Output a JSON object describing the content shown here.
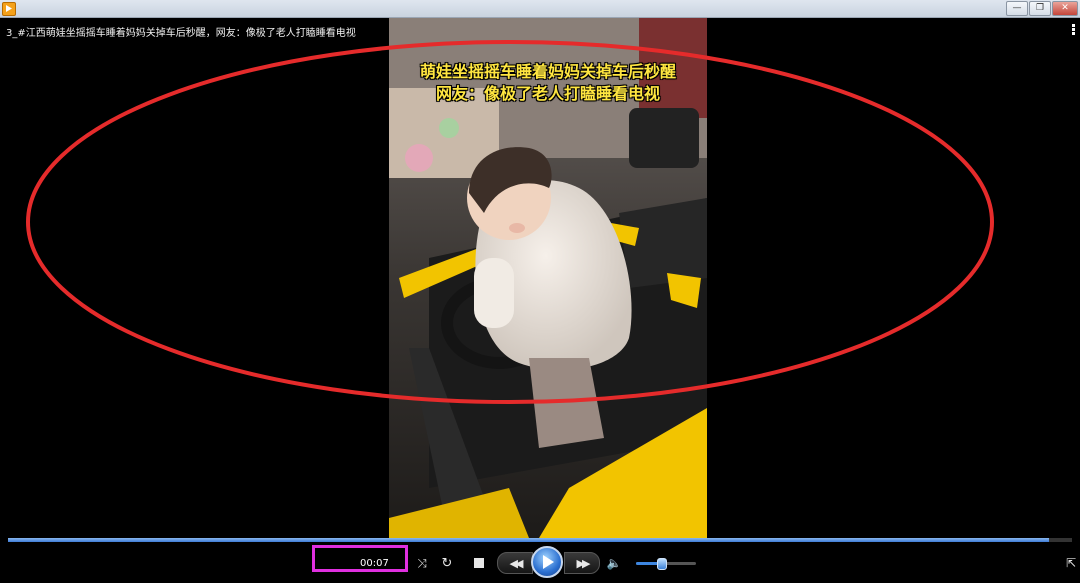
{
  "window": {
    "title": "3_#江西萌娃坐摇摇车睡着妈妈关掉车后秒醒，网友：像极了老人打瞌睡看电视",
    "buttons": {
      "minimize": "—",
      "maximize": "❐",
      "close": "✕"
    }
  },
  "video": {
    "caption_line1": "萌娃坐摇摇车睡着妈妈关掉车后秒醒",
    "caption_line2": "网友：像极了老人打瞌睡看电视",
    "progress_fraction": 0.978
  },
  "annotations": {
    "ellipse_color": "#e52b2b",
    "time_highlight_color": "#e030e0"
  },
  "controls": {
    "time": "00:07",
    "volume_fraction": 0.42,
    "icons": {
      "shuffle": "shuffle-icon",
      "repeat": "repeat-icon",
      "stop": "stop-icon",
      "previous": "previous-icon",
      "play": "play-icon",
      "next": "next-icon",
      "volume": "volume-icon",
      "fullscreen": "fullscreen-icon"
    },
    "glyphs": {
      "shuffle": "⤨",
      "repeat": "↻",
      "previous": "◀◀",
      "next": "▶▶",
      "volume": "🔈",
      "fullscreen": "⇱"
    }
  },
  "accent_color": "#3d7bd6"
}
